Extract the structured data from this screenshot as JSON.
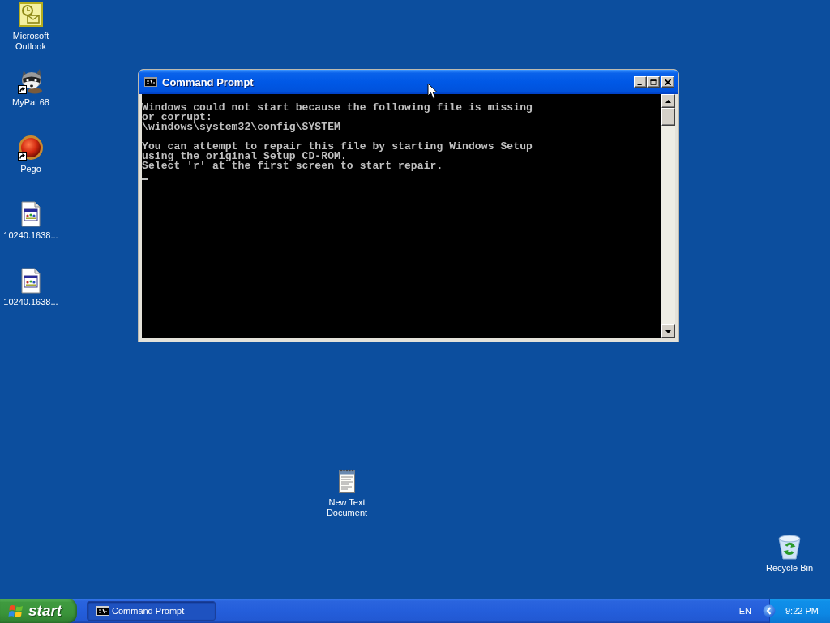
{
  "desktop_icons": [
    {
      "label": "Microsoft Outlook",
      "kind": "outlook",
      "shortcut": false
    },
    {
      "label": "MyPal 68",
      "kind": "raccoon",
      "shortcut": true
    },
    {
      "label": "Pego",
      "kind": "ball",
      "shortcut": true
    },
    {
      "label": "10240.1638...",
      "kind": "document",
      "shortcut": false
    },
    {
      "label": "10240.1638...",
      "kind": "document",
      "shortcut": false
    },
    {
      "label": "New Text Document",
      "kind": "notepad",
      "shortcut": false
    },
    {
      "label": "Recycle Bin",
      "kind": "recycle_bin",
      "shortcut": false
    }
  ],
  "window": {
    "title": "Command Prompt",
    "active": true,
    "console": {
      "paragraphs": [
        [
          "Windows could not start because the following file is missing",
          "or corrupt:",
          "\\windows\\system32\\config\\SYSTEM"
        ],
        [
          "You can attempt to repair this file by starting Windows Setup",
          "using the original Setup CD-ROM.",
          "Select 'r' at the first screen to start repair."
        ]
      ],
      "cursor": true
    }
  },
  "taskbar": {
    "start": "start",
    "tasks": [
      {
        "label": "Command Prompt",
        "selected": true
      }
    ],
    "language": "EN",
    "clock": "9:22 PM"
  }
}
